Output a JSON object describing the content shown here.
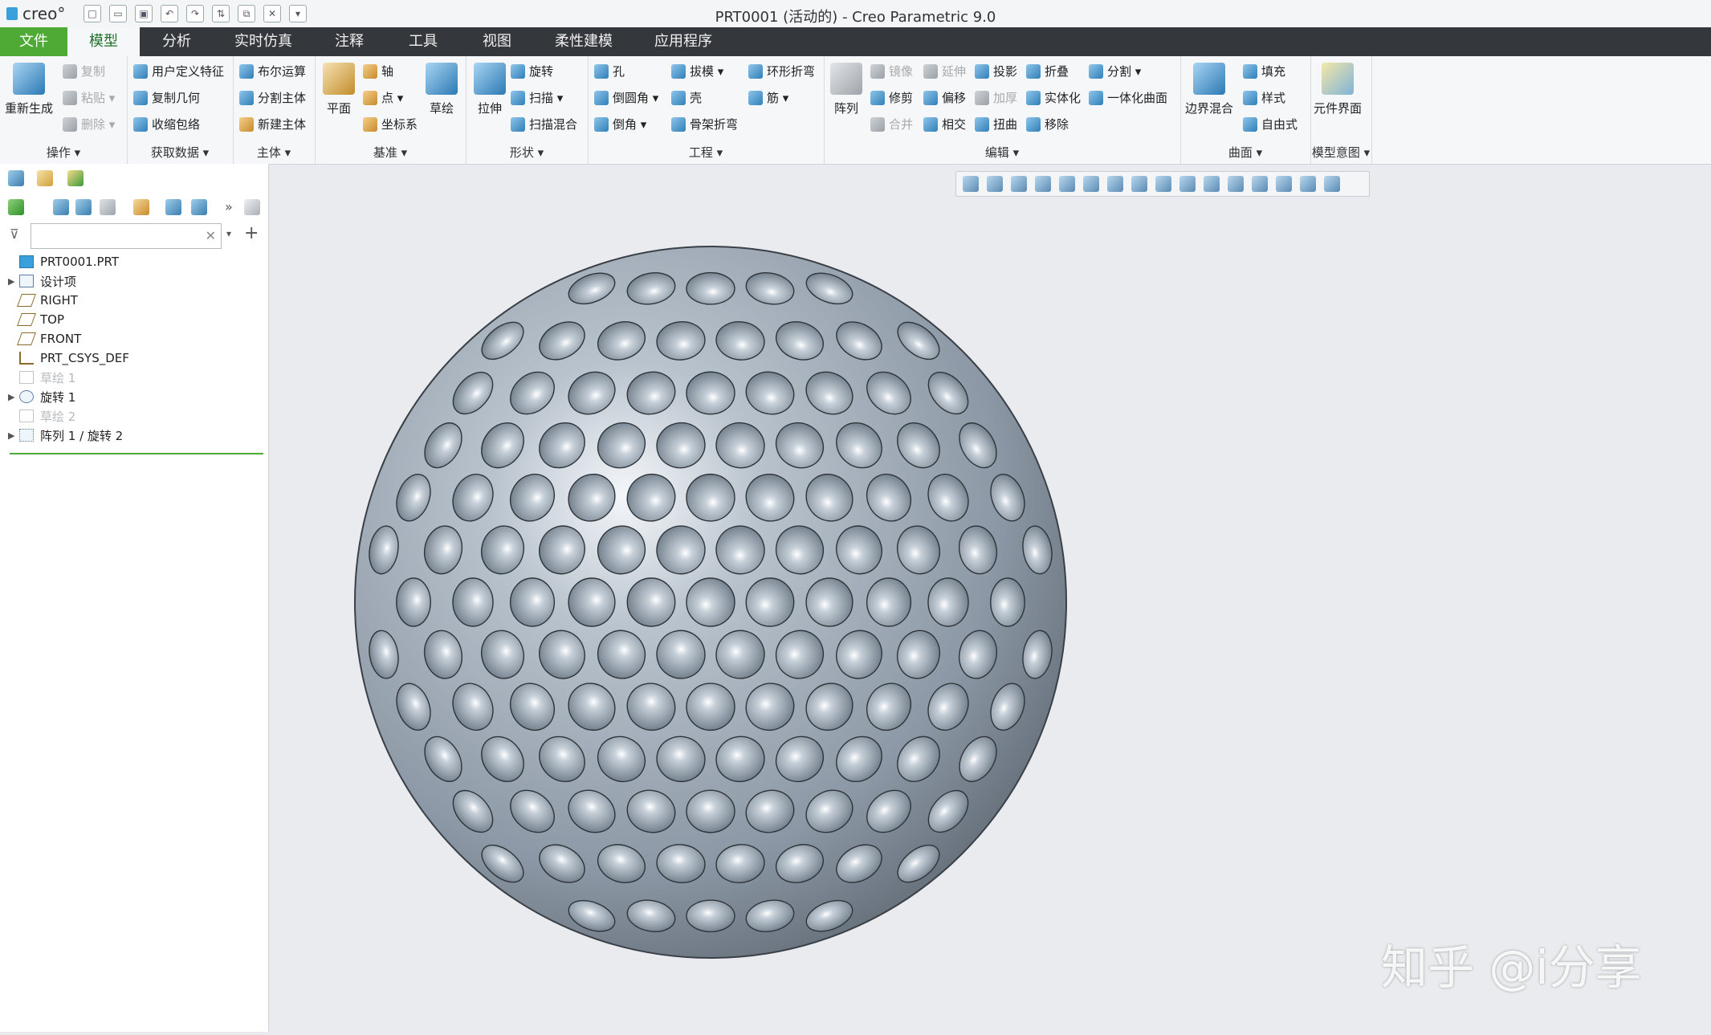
{
  "app": {
    "logo": "creo°",
    "window_title": "PRT0001 (活动的) - Creo Parametric 9.0",
    "quick_access": [
      "new-icon",
      "open-icon",
      "save-icon",
      "undo-icon",
      "redo-icon",
      "regenerate-icon",
      "window-icon",
      "close-icon",
      "more-icon"
    ]
  },
  "tabs": [
    "文件",
    "模型",
    "分析",
    "实时仿真",
    "注释",
    "工具",
    "视图",
    "柔性建模",
    "应用程序"
  ],
  "ribbon": {
    "operations": {
      "label": "操作 ▾",
      "regen": "重新生成",
      "copy": "复制",
      "paste": "粘贴 ▾",
      "delete": "删除 ▾"
    },
    "get_data": {
      "label": "获取数据 ▾",
      "udf": "用户定义特征",
      "copy_geom": "复制几何",
      "shrinkwrap": "收缩包络"
    },
    "body": {
      "label": "主体 ▾",
      "boolean": "布尔运算",
      "split_body": "分割主体",
      "new_body": "新建主体"
    },
    "datum": {
      "label": "基准 ▾",
      "plane": "平面",
      "axis": "轴",
      "point": "点 ▾",
      "csys": "坐标系",
      "sketch": "草绘"
    },
    "shapes": {
      "label": "形状 ▾",
      "extrude": "拉伸",
      "revolve": "旋转",
      "sweep": "扫描 ▾",
      "swept_blend": "扫描混合"
    },
    "engineering": {
      "label": "工程 ▾",
      "hole": "孔",
      "round": "倒圆角 ▾",
      "chamfer": "倒角 ▾",
      "draft": "拔模 ▾",
      "shell": "壳",
      "rib": "筋 ▾",
      "toroidal": "环形折弯",
      "spinal": "骨架折弯"
    },
    "editing": {
      "label": "编辑 ▾",
      "pattern": "阵列",
      "mirror": "镜像",
      "extend": "延伸",
      "project": "投影",
      "fold": "折叠",
      "split": "分割 ▾",
      "trim": "修剪",
      "offset": "偏移",
      "thicken": "加厚",
      "solidify": "实体化",
      "unify": "一体化曲面",
      "merge": "合并",
      "intersect": "相交",
      "twist": "扭曲",
      "remove": "移除"
    },
    "surfaces": {
      "label": "曲面 ▾",
      "boundary": "边界混合",
      "fill": "填充",
      "style": "样式",
      "freestyle": "自由式"
    },
    "model_intent": {
      "label": "模型意图 ▾",
      "component_interface": "元件界面"
    }
  },
  "search": {
    "placeholder": ""
  },
  "tree": [
    {
      "label": "PRT0001.PRT",
      "expand": "",
      "disabled": false,
      "icon": "part-icon"
    },
    {
      "label": "设计项",
      "expand": "▶",
      "disabled": false,
      "icon": "design-items-icon"
    },
    {
      "label": "RIGHT",
      "expand": "",
      "disabled": false,
      "icon": "datum-plane-icon"
    },
    {
      "label": "TOP",
      "expand": "",
      "disabled": false,
      "icon": "datum-plane-icon"
    },
    {
      "label": "FRONT",
      "expand": "",
      "disabled": false,
      "icon": "datum-plane-icon"
    },
    {
      "label": "PRT_CSYS_DEF",
      "expand": "",
      "disabled": false,
      "icon": "csys-icon"
    },
    {
      "label": "草绘 1",
      "expand": "",
      "disabled": true,
      "icon": "sketch-icon"
    },
    {
      "label": "旋转 1",
      "expand": "▶",
      "disabled": false,
      "icon": "revolve-icon"
    },
    {
      "label": "草绘 2",
      "expand": "",
      "disabled": true,
      "icon": "sketch-icon"
    },
    {
      "label": "阵列 1 / 旋转 2",
      "expand": "▶",
      "disabled": false,
      "icon": "pattern-icon"
    }
  ],
  "watermark": "知乎 @i分享",
  "colors": {
    "tabbar": "#34373b",
    "file_tab": "#4eaa34",
    "canvas": "#e9ebee",
    "ball": "#9aa6b2"
  }
}
